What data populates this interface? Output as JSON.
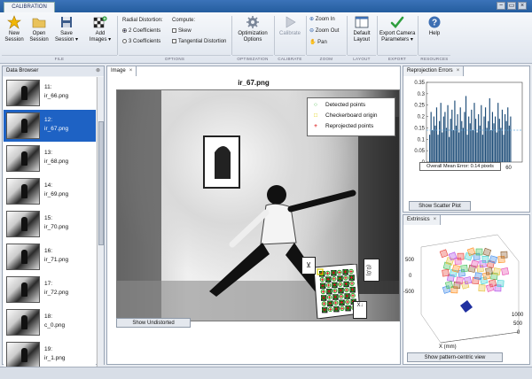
{
  "app": {
    "tab_title": "CALIBRATION"
  },
  "window_controls": [
    "−",
    "▭",
    "×"
  ],
  "toolstrip": {
    "file": {
      "new_session": "New\nSession",
      "open_session": "Open\nSession",
      "save_session": "Save\nSession ▾",
      "add_images": "Add\nImages ▾",
      "label": "FILE"
    },
    "options": {
      "radial_heading": "Radial Distortion:",
      "coef2": "2 Coefficients",
      "coef3": "3 Coefficients",
      "compute_heading": "Compute:",
      "skew": "Skew",
      "tangential": "Tangential Distortion",
      "label": "OPTIONS"
    },
    "optimization": {
      "button": "Optimization\nOptions",
      "label": "OPTIMIZATION"
    },
    "calibrate": {
      "button": "Calibrate",
      "label": "CALIBRATE"
    },
    "zoom": {
      "zoom_in": "Zoom In",
      "zoom_out": "Zoom Out",
      "pan": "Pan",
      "label": "ZOOM"
    },
    "layout": {
      "button": "Default\nLayout",
      "label": "LAYOUT"
    },
    "export": {
      "button": "Export Camera\nParameters ▾",
      "label": "EXPORT"
    },
    "help": {
      "button": "Help",
      "label": "RESOURCES"
    }
  },
  "data_browser": {
    "title": "Data Browser",
    "items": [
      {
        "num": "11:",
        "name": "ir_66.png"
      },
      {
        "num": "12:",
        "name": "ir_67.png",
        "selected": true
      },
      {
        "num": "13:",
        "name": "ir_68.png"
      },
      {
        "num": "14:",
        "name": "ir_69.png"
      },
      {
        "num": "15:",
        "name": "ir_70.png"
      },
      {
        "num": "16:",
        "name": "ir_71.png"
      },
      {
        "num": "17:",
        "name": "ir_72.png"
      },
      {
        "num": "18:",
        "name": "c_0.png"
      },
      {
        "num": "19:",
        "name": "ir_1.png"
      }
    ]
  },
  "image_panel": {
    "tab": "Image",
    "title": "ir_67.png",
    "legend": [
      {
        "label": "Detected points",
        "color": "#22aa22",
        "symbol": "○"
      },
      {
        "label": "Checkerboard origin",
        "color": "#ddcc00",
        "symbol": "□"
      },
      {
        "label": "Reprojected points",
        "color": "#dd2222",
        "symbol": "+"
      }
    ],
    "show_undistorted": "Show Undistorted",
    "sign_left": "⊻",
    "sign_right": "(0,0)",
    "sign_bottom": "X↓"
  },
  "reprojection": {
    "tab": "Reprojection Errors",
    "overall_label": "Overall Mean Error: 0.14 pixels",
    "show_scatter": "Show Scatter Plot",
    "chart_data": {
      "type": "bar",
      "ylim": [
        0,
        0.35
      ],
      "xlim": [
        0,
        70
      ],
      "mean": 0.14,
      "yticks": [
        "0",
        "0.05",
        "0.1",
        "0.15",
        "0.2",
        "0.25",
        "0.3",
        "0.35"
      ],
      "xticks": [
        "0",
        "20",
        "40",
        "60"
      ],
      "values": [
        0.12,
        0.22,
        0.14,
        0.2,
        0.16,
        0.24,
        0.12,
        0.18,
        0.26,
        0.13,
        0.2,
        0.22,
        0.15,
        0.25,
        0.11,
        0.19,
        0.23,
        0.14,
        0.27,
        0.16,
        0.21,
        0.13,
        0.24,
        0.18,
        0.15,
        0.22,
        0.29,
        0.12,
        0.2,
        0.17,
        0.23,
        0.14,
        0.26,
        0.19,
        0.13,
        0.21,
        0.16,
        0.25,
        0.12,
        0.2,
        0.24,
        0.15,
        0.18,
        0.28,
        0.14,
        0.22,
        0.17,
        0.2,
        0.13,
        0.26,
        0.19,
        0.15,
        0.23,
        0.12,
        0.21,
        0.18,
        0.24,
        0.16,
        0.2
      ]
    }
  },
  "extrinsics": {
    "tab": "Extrinsics",
    "show_pattern": "Show pattern-centric view",
    "xlabel": "X (mm)",
    "ytick_left": [
      "500",
      "0",
      "-500"
    ],
    "ytick_right": [
      "1000",
      "500",
      "0"
    ]
  },
  "colors": {
    "accent": "#1e62c4",
    "bar": "#1f4e79"
  }
}
